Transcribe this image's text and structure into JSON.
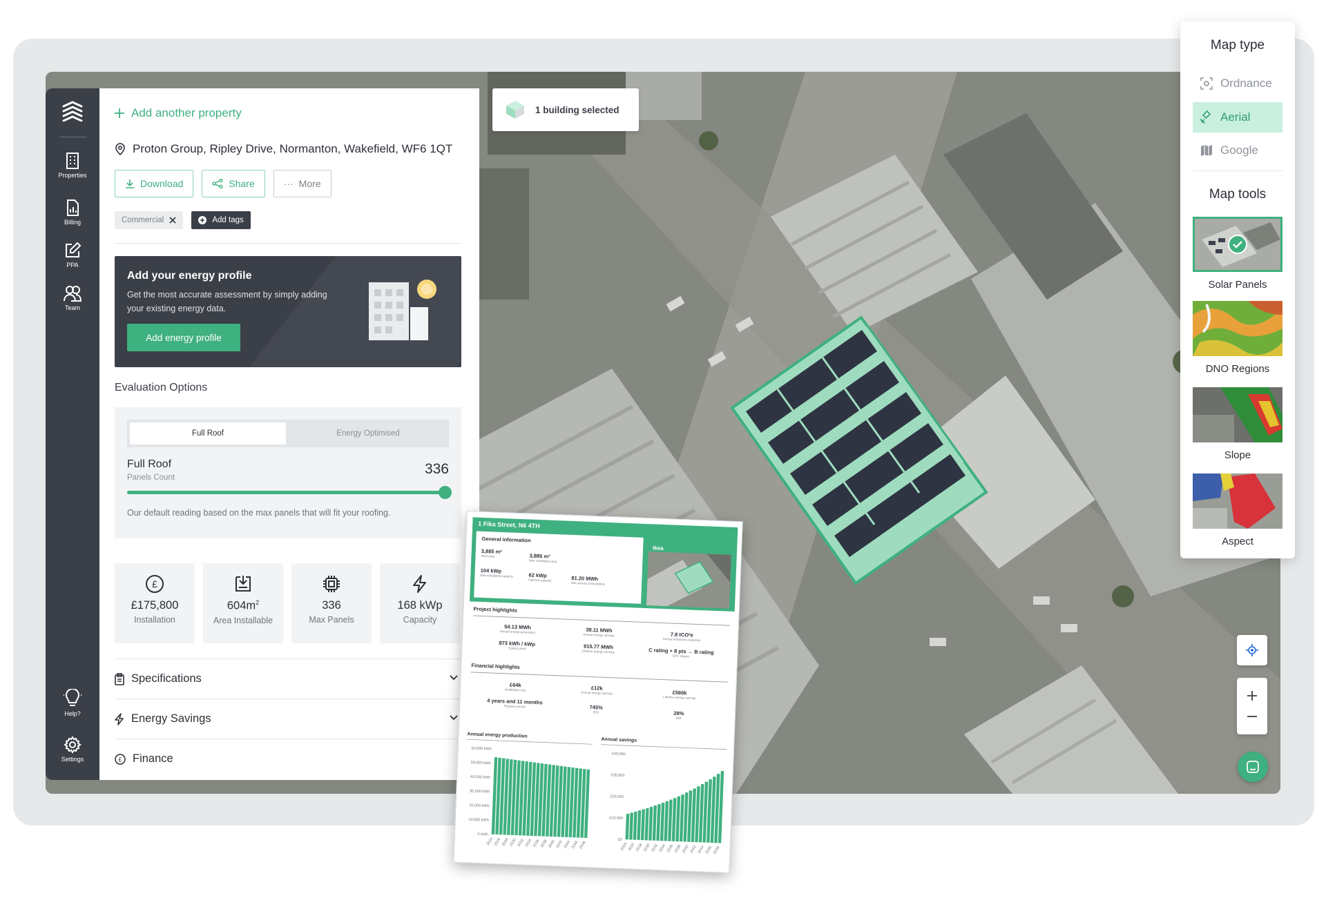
{
  "sidebar": {
    "items": [
      {
        "label": "Properties"
      },
      {
        "label": "Billing"
      },
      {
        "label": "PPA"
      },
      {
        "label": "Team"
      }
    ],
    "bottom": [
      {
        "label": "Help?"
      },
      {
        "label": "Settings"
      }
    ]
  },
  "panel": {
    "add_property": "Add another property",
    "address": "Proton Group, Ripley Drive, Normanton, Wakefield, WF6 1QT",
    "buttons": {
      "download": "Download",
      "share": "Share",
      "more": "More"
    },
    "tags": {
      "commercial": "Commercial",
      "add_tags": "Add tags"
    },
    "energy_profile": {
      "title": "Add your energy profile",
      "text": "Get the most accurate assessment by simply adding your existing energy data.",
      "button": "Add energy profile"
    },
    "evaluation": {
      "title": "Evaluation Options",
      "options": [
        "Full Roof",
        "Energy Optimised"
      ],
      "selected_label": "Full Roof",
      "selected_sub": "Panels Count",
      "value": "336",
      "slider_fraction": 1.0,
      "note": "Our default reading based on the max panels that will fit your roofing."
    },
    "stats": [
      {
        "value": "£175,800",
        "label": "Installation"
      },
      {
        "value": "604m",
        "sup": "2",
        "label": "Area Installable"
      },
      {
        "value": "336",
        "label": "Max Panels"
      },
      {
        "value": "168 kWp",
        "label": "Capacity"
      }
    ],
    "accordions": [
      "Specifications",
      "Energy Savings",
      "Finance"
    ]
  },
  "building_selected": "1 building selected",
  "map_type": {
    "title": "Map type",
    "options": [
      "Ordnance",
      "Aerial",
      "Google"
    ],
    "selected": "Aerial"
  },
  "map_tools": {
    "title": "Map tools",
    "tools": [
      "Solar Panels",
      "DNO Regions",
      "Slope",
      "Aspect"
    ],
    "selected": "Solar Panels"
  },
  "report": {
    "address": "1 Fika Street, N6 4TH",
    "site_name": "Ikea",
    "general": {
      "title": "General information",
      "cells": [
        {
          "v": "3,885 m²",
          "l": "Roof area"
        },
        {
          "v": "3,885 m²",
          "l": "Max installable area"
        },
        {
          "v": "104 kWp",
          "l": "Max installable capacity"
        },
        {
          "v": "62 kWp",
          "l": "Optimal capacity"
        },
        {
          "v": "81.20 MWh",
          "l": "Site annual consumption"
        }
      ]
    },
    "project": {
      "title": "Project highlights",
      "cells": [
        {
          "v": "54.13 MWh",
          "l": "Annual energy generation"
        },
        {
          "v": "39.11 MWh",
          "l": "Annual energy savings"
        },
        {
          "v": "7.8 tCO²e",
          "l": "Annual emissions reduction"
        },
        {
          "v": "873 kWh / kWp",
          "l": "System yield"
        },
        {
          "v": "915.77 MWh",
          "l": "Lifetime energy savings"
        },
        {
          "v": "C rating + 8 pts → B rating",
          "l": "EPC impact"
        }
      ]
    },
    "financial": {
      "title": "Financial highlights",
      "cells": [
        {
          "v": "£64k",
          "l": "Installation cost"
        },
        {
          "v": "£12k",
          "l": "Annual energy savings"
        },
        {
          "v": "£566k",
          "l": "Lifetime energy savings"
        },
        {
          "v": "4 years and 11 months",
          "l": "Payback period"
        },
        {
          "v": "745%",
          "l": "ROI"
        },
        {
          "v": "28%",
          "l": "IRR"
        }
      ]
    }
  },
  "chart_data": [
    {
      "type": "bar",
      "title": "Annual energy production",
      "y_ticks": [
        "60,000 kWh",
        "50,000 kWh",
        "40,000 kWh",
        "30,000 kWh",
        "20,000 kWh",
        "10,000 kWh",
        "0 kWh"
      ],
      "x_ticks": [
        "2024",
        "2026",
        "2028",
        "2030",
        "2032",
        "2034",
        "2036",
        "2038",
        "2040",
        "2042",
        "2044",
        "2046",
        "2048"
      ],
      "ylim": [
        0,
        60000
      ],
      "x_start": 2024,
      "values": [
        54130,
        53860,
        53590,
        53320,
        53060,
        52790,
        52530,
        52270,
        52010,
        51750,
        51490,
        51230,
        50970,
        50710,
        50460,
        50210,
        49960,
        49710,
        49460,
        49210,
        48960,
        48720,
        48480,
        48240,
        48000
      ],
      "color": "#3fb07f"
    },
    {
      "type": "bar",
      "title": "Annual savings",
      "y_ticks": [
        "£40,000",
        "£30,000",
        "£20,000",
        "£10,000",
        "£0"
      ],
      "x_ticks": [
        "2024",
        "2026",
        "2028",
        "2030",
        "2032",
        "2034",
        "2036",
        "2038",
        "2040",
        "2042",
        "2044",
        "2046",
        "2048"
      ],
      "ylim": [
        0,
        40000
      ],
      "x_start": 2024,
      "values": [
        12000,
        12600,
        13200,
        13800,
        14400,
        15000,
        15700,
        16400,
        17100,
        17800,
        18600,
        19400,
        20200,
        21100,
        22000,
        23000,
        24000,
        25000,
        26100,
        27200,
        28400,
        29600,
        30900,
        32300,
        33700
      ],
      "color": "#3fb07f"
    }
  ],
  "colors": {
    "accent": "#3fb07f",
    "sidebar": "#3b3f47"
  }
}
